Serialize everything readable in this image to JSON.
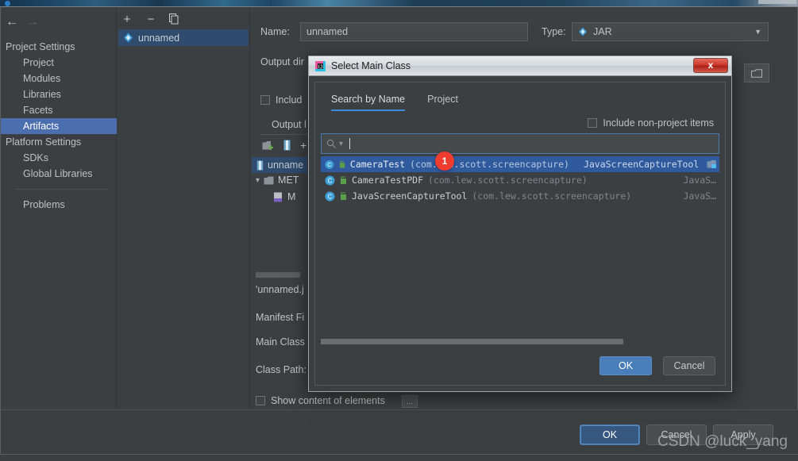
{
  "desktop": {
    "hint_text": ""
  },
  "sidebar": {
    "back_icon": "back-arrow-icon",
    "forward_icon": "forward-arrow-icon",
    "groups": [
      {
        "label": "Project Settings",
        "items": [
          {
            "label": "Project",
            "selected": false
          },
          {
            "label": "Modules",
            "selected": false
          },
          {
            "label": "Libraries",
            "selected": false
          },
          {
            "label": "Facets",
            "selected": false
          },
          {
            "label": "Artifacts",
            "selected": true
          }
        ]
      },
      {
        "label": "Platform Settings",
        "items": [
          {
            "label": "SDKs",
            "selected": false
          },
          {
            "label": "Global Libraries",
            "selected": false
          }
        ]
      }
    ],
    "problems_label": "Problems",
    "help_label": "?"
  },
  "artifacts": {
    "toolbar": [
      {
        "name": "add-artifact-button",
        "glyph": "+"
      },
      {
        "name": "remove-artifact-button",
        "glyph": "−"
      },
      {
        "name": "copy-artifact-button",
        "glyph": "❐"
      }
    ],
    "items": [
      {
        "label": "unnamed",
        "icon": "jar-artifact-icon",
        "selected": true
      }
    ]
  },
  "detail": {
    "name_label": "Name:",
    "name_value": "unnamed",
    "type_label": "Type:",
    "type_value": "JAR",
    "output_dir_label": "Output dir",
    "include_label": "Includ",
    "output_layout_label": "Output l",
    "tree": {
      "root": "unname",
      "child": "MET",
      "grandchild": "M"
    },
    "unnamed_jar_label": "'unnamed.j",
    "manifest_label": "Manifest Fi",
    "main_class_label": "Main Class",
    "class_path_label": "Class Path:",
    "show_content_label": "Show content of elements",
    "ellipsis_label": "..."
  },
  "main_buttons": {
    "ok": "OK",
    "cancel": "Cancel",
    "apply": "Apply"
  },
  "watermark": "CSDN @luck_yang",
  "dialog": {
    "title": "Select Main Class",
    "title_icon": "intellij-idea-icon",
    "close_label": "x",
    "tabs": [
      {
        "label": "Search by Name",
        "active": true
      },
      {
        "label": "Project",
        "active": false
      }
    ],
    "include_non_project_label": "Include non-project items",
    "include_non_project_checked": false,
    "search_placeholder": "",
    "search_value": "",
    "search_icon": "magnifier-icon",
    "results": [
      {
        "class_name": "CameraTest",
        "package": "(com.lew.scott.screencapture)",
        "module": "JavaScreenCaptureTool",
        "selected": true,
        "class_icon": "java-class-icon",
        "visibility_icon": "public-member-icon",
        "module_icon": "module-icon"
      },
      {
        "class_name": "CameraTestPDF",
        "package": "(com.lew.scott.screencapture)",
        "module": "JavaS…",
        "selected": false,
        "class_icon": "java-class-icon",
        "visibility_icon": "public-member-icon",
        "module_icon": ""
      },
      {
        "class_name": "JavaScreenCaptureTool",
        "package": "(com.lew.scott.screencapture)",
        "module": "JavaS…",
        "selected": false,
        "class_icon": "java-class-icon",
        "visibility_icon": "public-member-icon",
        "module_icon": ""
      }
    ],
    "buttons": {
      "ok": "OK",
      "cancel": "Cancel"
    },
    "step_badge": "1"
  },
  "colors": {
    "accent": "#4b6eaf",
    "selection": "#2f5a9e",
    "tab_underline": "#3d8ade",
    "badge": "#f03c2e",
    "primary_button": "#4a7ebb"
  }
}
